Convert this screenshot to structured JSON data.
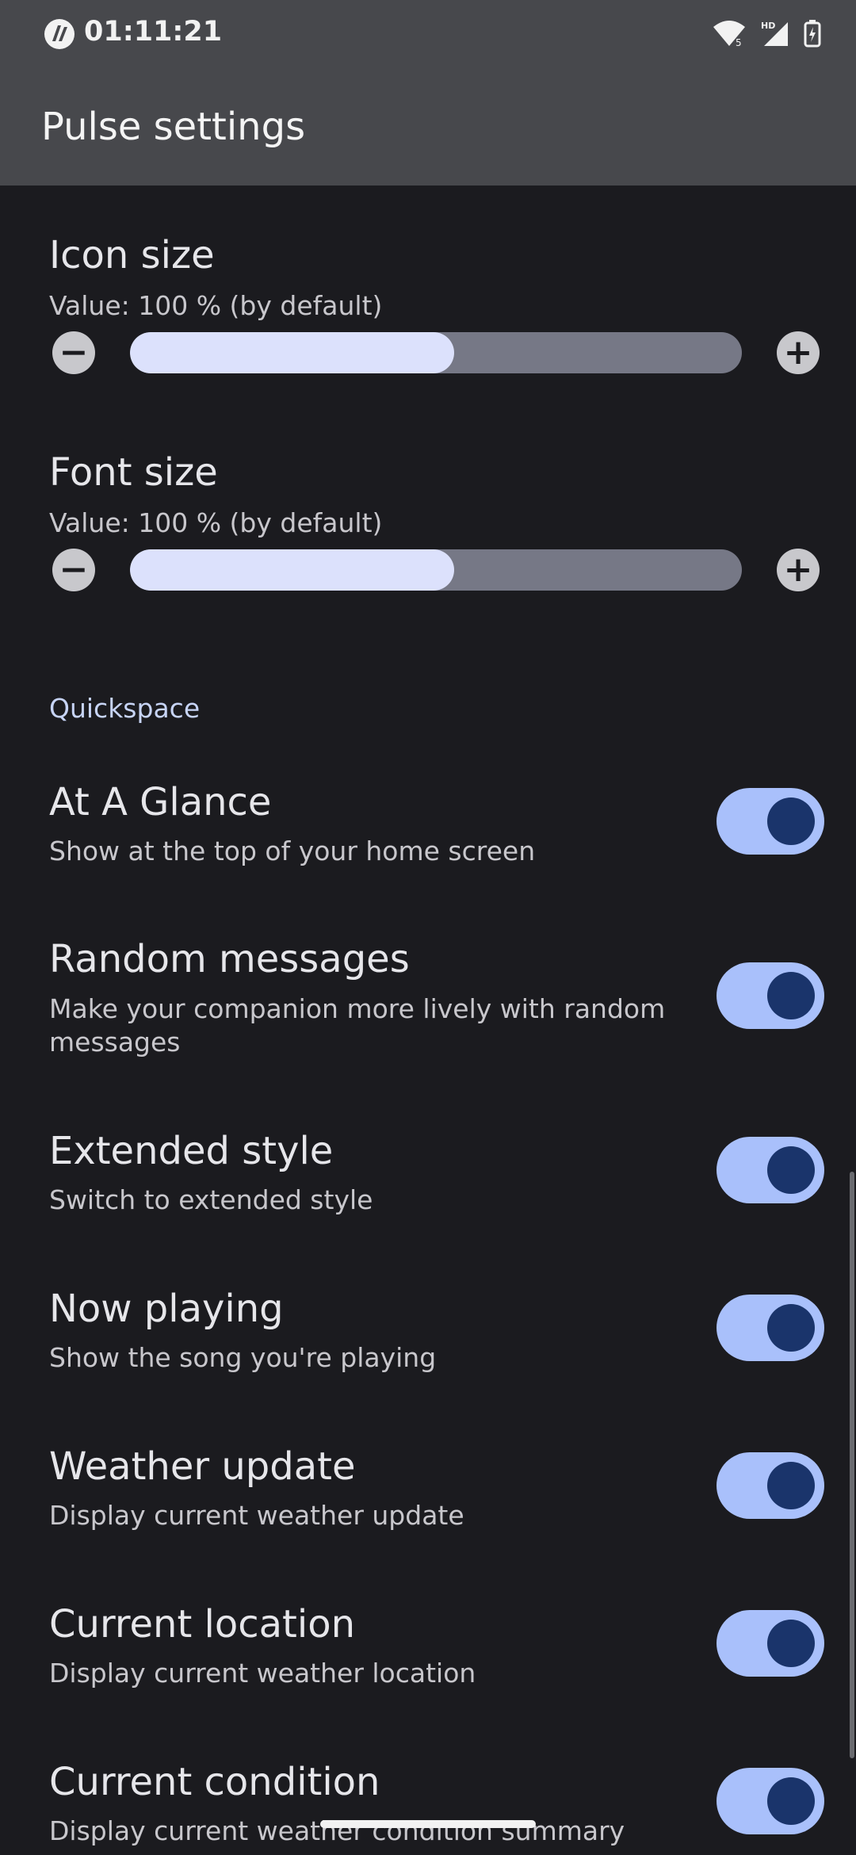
{
  "status_bar": {
    "time": "01:11:21",
    "icons": [
      "app-logo-icon",
      "wifi-icon",
      "signal-hd-icon",
      "battery-charging-icon"
    ]
  },
  "app_bar": {
    "title": "Pulse settings"
  },
  "sliders": [
    {
      "title": "Icon size",
      "summary": "Value: 100 % (by default)",
      "level": 0.53
    },
    {
      "title": "Font size",
      "summary": "Value: 100 % (by default)",
      "level": 0.53
    }
  ],
  "section": {
    "header": "Quickspace"
  },
  "switches": [
    {
      "title": "At A Glance",
      "summary": "Show at the top of your home screen",
      "on": true
    },
    {
      "title": "Random messages",
      "summary": "Make your companion more lively with random messages",
      "on": true
    },
    {
      "title": "Extended style",
      "summary": "Switch to extended style",
      "on": true
    },
    {
      "title": "Now playing",
      "summary": "Show the song you're playing",
      "on": true
    },
    {
      "title": "Weather update",
      "summary": "Display current weather update",
      "on": true
    },
    {
      "title": "Current location",
      "summary": "Display current weather location",
      "on": true
    },
    {
      "title": "Current condition",
      "summary": "Display current weather condition summary",
      "on": true
    }
  ],
  "colors": {
    "background": "#1b1b1f",
    "app_bar": "#47484c",
    "accent_switch": "#a9c0fb",
    "switch_thumb": "#1a346b",
    "slider_fill": "#dce1fc"
  }
}
